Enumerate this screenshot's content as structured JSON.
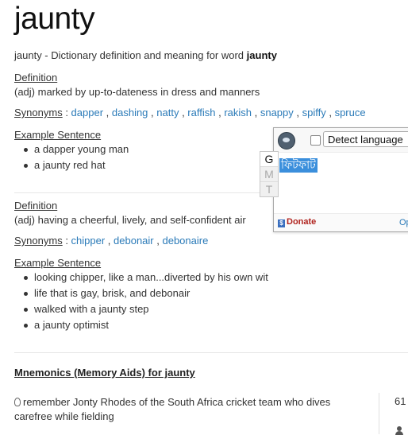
{
  "word": "jaunty",
  "subtitle": {
    "prefix": "jaunty - Dictionary definition and meaning for word ",
    "word": "jaunty"
  },
  "definitions": [
    {
      "heading": "Definition",
      "text": "(adj) marked by up-to-dateness in dress and manners",
      "synonyms_label": "Synonyms",
      "synonyms": [
        "dapper",
        "dashing",
        "natty",
        "raffish",
        "rakish",
        "snappy",
        "spiffy",
        "spruce"
      ],
      "example_heading": "Example Sentence",
      "examples": [
        "a dapper young man",
        "a jaunty red hat"
      ]
    },
    {
      "heading": "Definition",
      "text": "(adj) having a cheerful, lively, and self-confident air",
      "synonyms_label": "Synonyms",
      "synonyms": [
        "chipper",
        "debonair",
        "debonaire"
      ],
      "example_heading": "Example Sentence",
      "examples": [
        "looking chipper, like a man...diverted by his own wit",
        "life that is gay, brisk, and debonair",
        "walked with a jaunty step",
        "a jaunty optimist"
      ]
    }
  ],
  "mnemonics": {
    "title": "Mnemonics (Memory Aids) for jaunty",
    "items": [
      {
        "text": "remember Jonty Rhodes of the South Africa cricket team who dives carefree while fielding",
        "count": "61"
      }
    ]
  },
  "translate_popup": {
    "detect_label": "Detect language",
    "translation": "ফিটফাট",
    "donate_label": "Donate",
    "options_label": "Op",
    "side_tabs": [
      "G",
      "M",
      "T"
    ]
  }
}
